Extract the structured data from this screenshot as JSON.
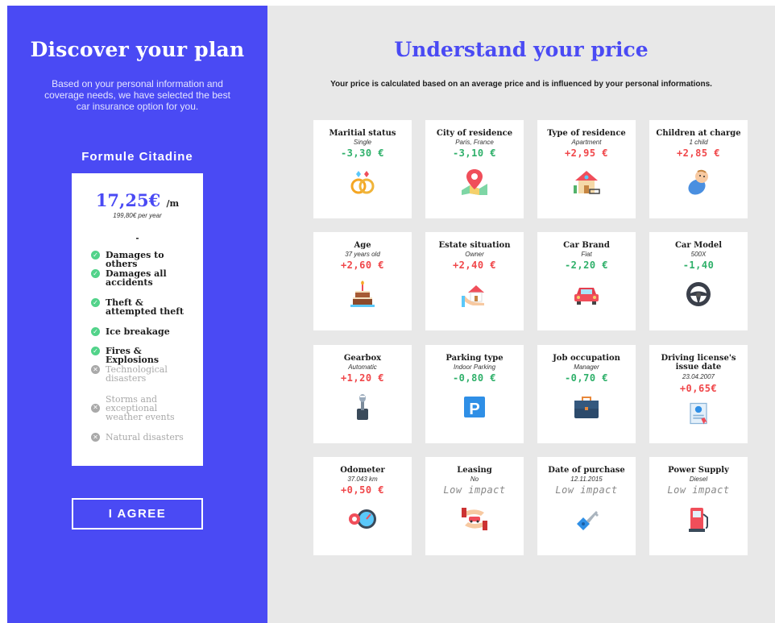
{
  "left": {
    "title": "Discover your plan",
    "subtitle": "Based on your personal information and coverage needs, we have selected the best car insurance option for you.",
    "formule": "Formule Citadine",
    "price": "17,25€",
    "price_unit": "/m",
    "price_year": "199,80€ per year",
    "separator": "-",
    "coverages": [
      {
        "label": "Damages to others",
        "included": true
      },
      {
        "label": "Damages all accidents",
        "included": true
      },
      {
        "label": "Theft & attempted theft",
        "included": true
      },
      {
        "label": "Ice breakage",
        "included": true
      },
      {
        "label": "Fires & Explosions",
        "included": true
      },
      {
        "label": "Technological disasters",
        "included": false
      },
      {
        "label": "Storms and exceptional weather events",
        "included": false
      },
      {
        "label": "Natural disasters",
        "included": false
      }
    ],
    "agree_label": "I AGREE"
  },
  "right": {
    "title": "Understand your price",
    "subtitle": "Your price is calculated based on an average price and is influenced by your personal informations.",
    "colors": {
      "negative": "#2fb06a",
      "positive": "#f0474a",
      "low": "#888888"
    },
    "cards": [
      {
        "title": "Maritial status",
        "value": "Single",
        "price": "-3,30 €",
        "kind": "neg",
        "icon": "rings-icon"
      },
      {
        "title": "City of residence",
        "value": "Paris, France",
        "price": "-3,10 €",
        "kind": "neg",
        "icon": "map-pin-icon"
      },
      {
        "title": "Type of residence",
        "value": "Apartment",
        "price": "+2,95 €",
        "kind": "pos",
        "icon": "house-icon"
      },
      {
        "title": "Children at charge",
        "value": "1 child",
        "price": "+2,85 €",
        "kind": "pos",
        "icon": "baby-icon"
      },
      {
        "title": "Age",
        "value": "37 years old",
        "price": "+2,60 €",
        "kind": "pos",
        "icon": "cake-icon"
      },
      {
        "title": "Estate situation",
        "value": "Owner",
        "price": "+2,40 €",
        "kind": "pos",
        "icon": "home-hand-icon"
      },
      {
        "title": "Car Brand",
        "value": "Fiat",
        "price": "-2,20 €",
        "kind": "neg",
        "icon": "car-icon"
      },
      {
        "title": "Car Model",
        "value": "500X",
        "price": "-1,40",
        "kind": "neg",
        "icon": "steering-wheel-icon"
      },
      {
        "title": "Gearbox",
        "value": "Automatic",
        "price": "+1,20 €",
        "kind": "pos",
        "icon": "gear-stick-icon"
      },
      {
        "title": "Parking type",
        "value": "Indoor Parking",
        "price": "-0,80 €",
        "kind": "neg",
        "icon": "parking-icon"
      },
      {
        "title": "Job occupation",
        "value": "Manager",
        "price": "-0,70 €",
        "kind": "neg",
        "icon": "briefcase-icon"
      },
      {
        "title": "Driving license's issue date",
        "value": "23.04.2007",
        "price": "+0,65€",
        "kind": "pos",
        "icon": "certificate-icon"
      },
      {
        "title": "Odometer",
        "value": "37.043 km",
        "price": "+0,50 €",
        "kind": "pos",
        "icon": "odometer-icon"
      },
      {
        "title": "Leasing",
        "value": "No",
        "price": "Low impact",
        "kind": "low",
        "icon": "leasing-icon"
      },
      {
        "title": "Date of purchase",
        "value": "12.11.2015",
        "price": "Low impact",
        "kind": "low",
        "icon": "car-key-icon"
      },
      {
        "title": "Power Supply",
        "value": "Diesel",
        "price": "Low impact",
        "kind": "low",
        "icon": "fuel-pump-icon"
      }
    ]
  }
}
